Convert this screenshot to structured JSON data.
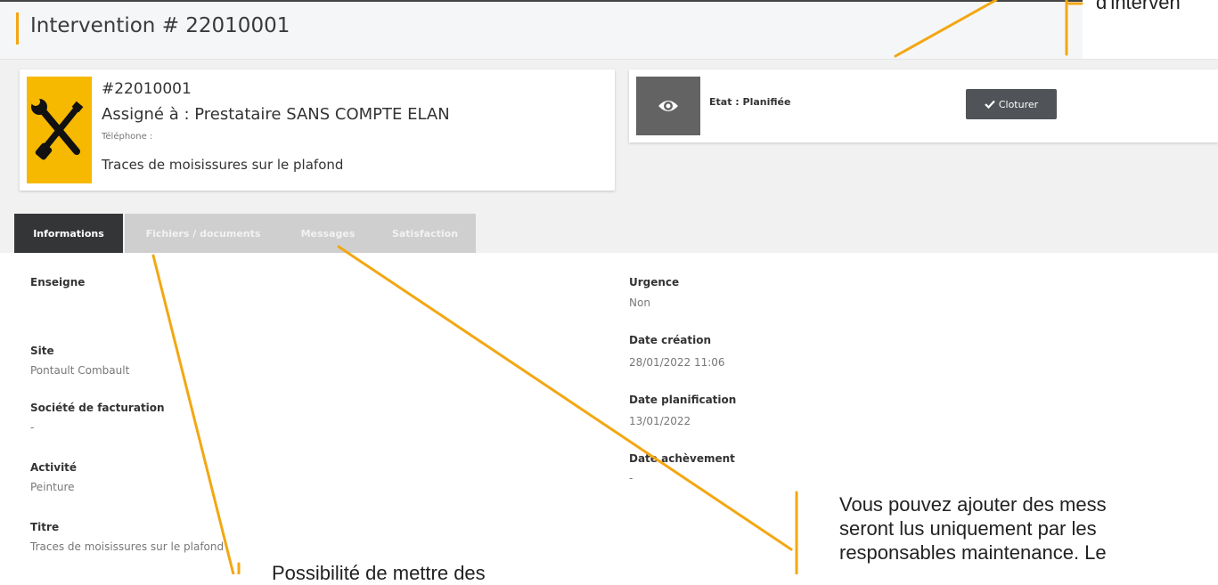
{
  "header": {
    "title": "Intervention # 22010001"
  },
  "annotations": {
    "top_right": "d'interven",
    "messages_note": [
      "Vous pouvez ajouter des mess",
      "seront lus uniquement  par les",
      "responsables maintenance. Le"
    ],
    "files_note": "Possibilité de mettre des"
  },
  "intervention": {
    "number": "#22010001",
    "assigned": "Assigné à : Prestataire SANS COMPTE ELAN",
    "phone_label": "Téléphone :",
    "description": "Traces de moisissures sur le plafond"
  },
  "status": {
    "etat": "Etat : Planifiée",
    "close_label": "Cloturer"
  },
  "tabs": [
    {
      "label": "Informations",
      "active": true
    },
    {
      "label": "Fichiers / documents",
      "active": false
    },
    {
      "label": "Messages",
      "active": false
    },
    {
      "label": "Satisfaction",
      "active": false
    }
  ],
  "fields_left": [
    {
      "label": "Enseigne",
      "value": ""
    },
    {
      "label": "Site",
      "value": "Pontault Combault"
    },
    {
      "label": "Société de facturation",
      "value": "-"
    },
    {
      "label": "Activité",
      "value": "Peinture"
    },
    {
      "label": "Titre",
      "value": "Traces de moisissures sur le plafond"
    }
  ],
  "fields_right": [
    {
      "label": "Urgence",
      "value": "Non"
    },
    {
      "label": "Date création",
      "value": "28/01/2022 11:06"
    },
    {
      "label": "Date planification",
      "value": "13/01/2022"
    },
    {
      "label": "Date achèvement",
      "value": "-"
    }
  ],
  "colors": {
    "accent": "#f3a712",
    "tool_tile": "#f7b800",
    "active_tab": "#333537",
    "button": "#505357"
  },
  "icons": {
    "tool": "wrench-screwdriver-icon",
    "view": "eye-icon",
    "check": "check-icon"
  }
}
